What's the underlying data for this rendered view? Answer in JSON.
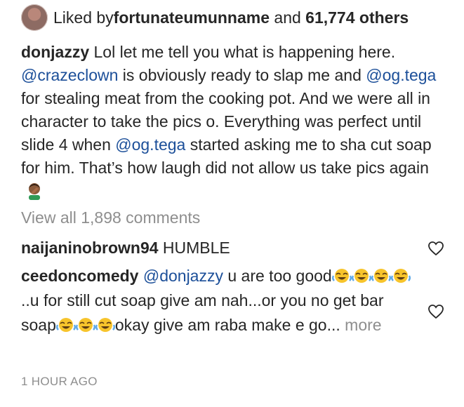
{
  "likes": {
    "prefix": "Liked by ",
    "username": "fortunateumunname",
    "middle": " and ",
    "count": "61,774 others"
  },
  "caption": {
    "username": "donjazzy",
    "part1": " Lol let me tell you what is happening here. ",
    "mention1": "@crazeclown",
    "part2": " is obviously ready to slap me and ",
    "mention2": "@og.tega",
    "part3": " for stealing meat from the cooking pot. And we were all in character to take the pics o. Everything was perfect until slide 4 when ",
    "mention3": "@og.tega",
    "part4": " started asking me to sha cut soap for him. That’s how laugh did not allow us take pics again",
    "emoji": "man-facepalming-emoji"
  },
  "view_all": "View all 1,898 comments",
  "comments": [
    {
      "username": "naijaninobrown94",
      "text": " HUMBLE"
    },
    {
      "username": "ceedoncomedy",
      "mention": "@donjazzy",
      "part1": " u are too good",
      "part2": "..u for still cut soap give am nah...or you no get bar soap",
      "part3": "okay give am raba make e go",
      "ellipsis": "...",
      "more": "more"
    }
  ],
  "timestamp": "1 HOUR AGO",
  "icons": {
    "heart": "heart-outline-icon",
    "laugh": "face-with-tears-of-joy-emoji"
  },
  "colors": {
    "text": "#262626",
    "link": "#1c4f99",
    "muted": "#8e8e8e"
  }
}
